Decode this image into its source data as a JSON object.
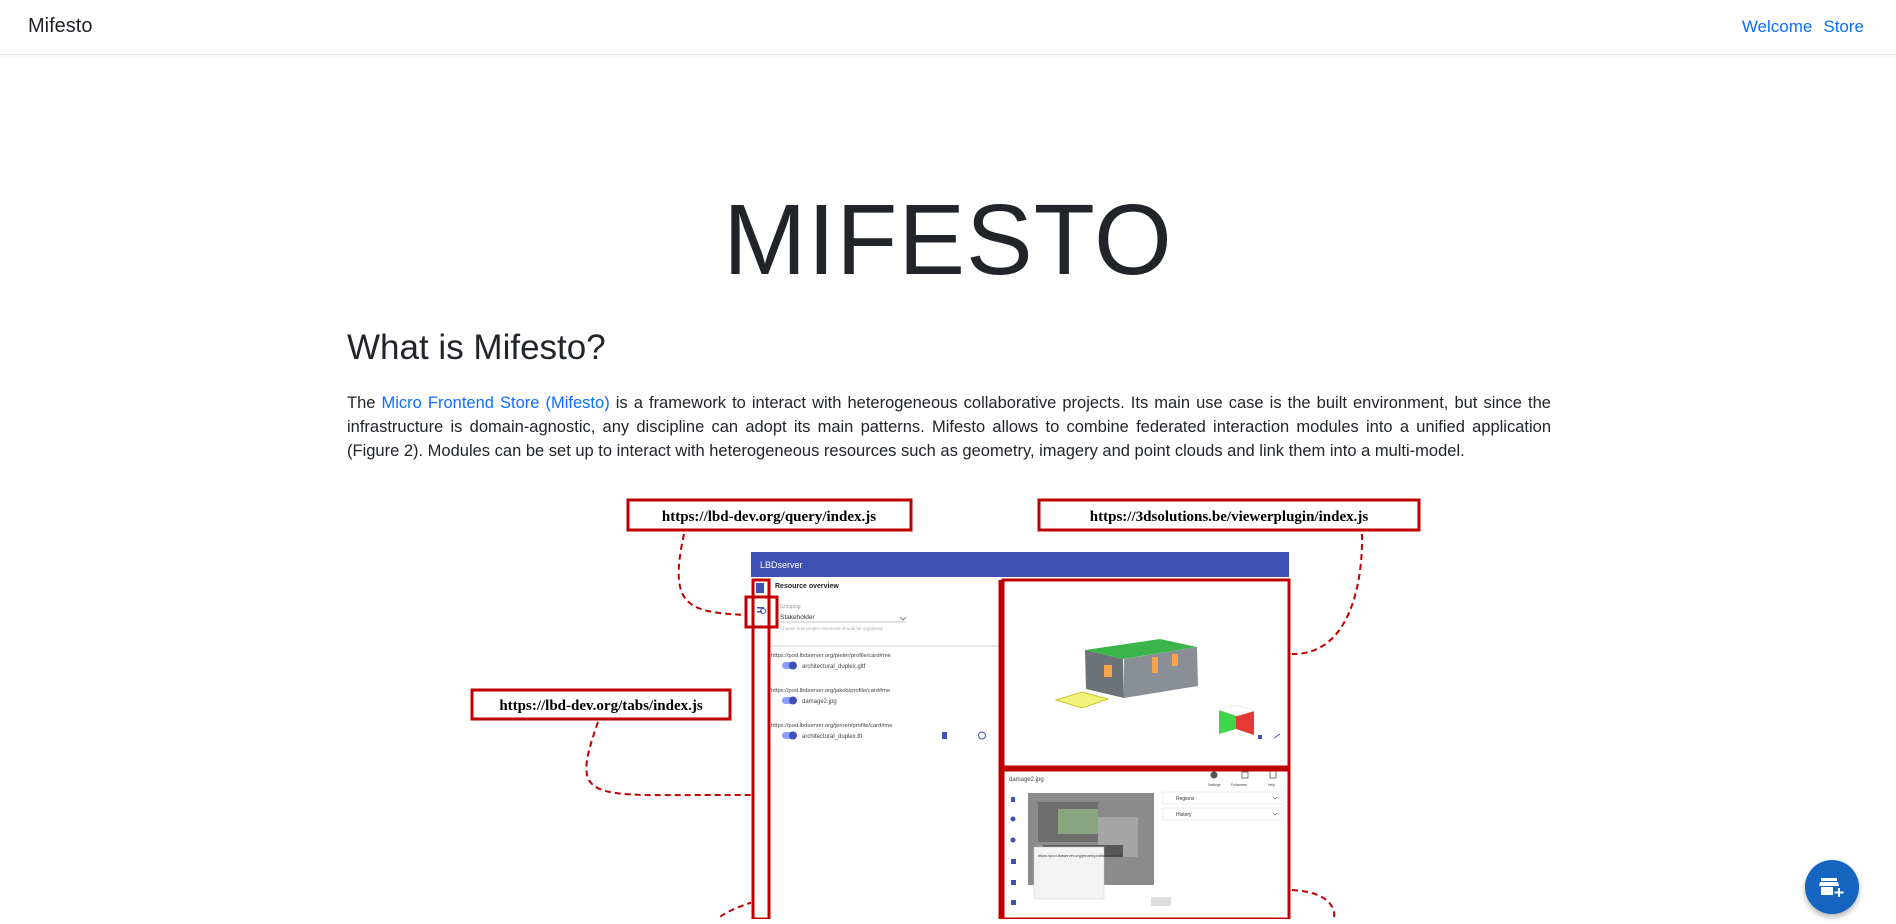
{
  "nav": {
    "brand": "Mifesto",
    "links": [
      {
        "label": "Welcome"
      },
      {
        "label": "Store"
      }
    ]
  },
  "hero": {
    "title": "MIFESTO"
  },
  "section": {
    "heading": "What is Mifesto?",
    "intro_pre": "The ",
    "link_text": "Micro Frontend Store (Mifesto)",
    "intro_post": " is a framework to interact with heterogeneous collaborative projects. Its main use case is the built environment, but since the infrastructure is domain-agnostic, any discipline can adopt its main patterns. Mifesto allows to combine federated interaction modules into a unified application (Figure 2). Modules can be set up to interact with heterogeneous resources such as geometry, imagery and point clouds and link them into a multi-model."
  },
  "figure": {
    "labels": {
      "query": "https://lbd-dev.org/query/index.js",
      "viewer": "https://3dsolutions.be/viewerplugin/index.js",
      "tabs": "https://lbd-dev.org/tabs/index.js"
    },
    "app": {
      "title": "LBDserver",
      "panel_title": "Resource overview",
      "grouping_label": "Grouping",
      "grouping_value": "Stakeholder",
      "grouping_hint": "Choose how project resources should be organised",
      "resources": [
        {
          "owner": "https://pod.lbdserver.org/pieter/profile/card#me",
          "file": "architectural_duplex.gltf"
        },
        {
          "owner": "https://pod.lbdserver.org/jakob/profile/card#me",
          "file": "damage2.jpg"
        },
        {
          "owner": "https://pod.lbdserver.org/jeroen/profile/card#me",
          "file": "architectural_duplex.ttl"
        }
      ],
      "image_panel_title": "damage2.jpg",
      "image_tools": [
        "Settings",
        "Fullscreen",
        "Help"
      ],
      "side_items": [
        "Regions",
        "History"
      ],
      "popup_owner": "https://pod.lbdserver.org/jeroen/profile/card#me"
    }
  },
  "colors": {
    "link": "#0d6efd",
    "header_bar": "#3f51b5",
    "frame": "#c00000",
    "fab": "#1565c0"
  },
  "fab": {
    "icon": "add-store-icon"
  }
}
